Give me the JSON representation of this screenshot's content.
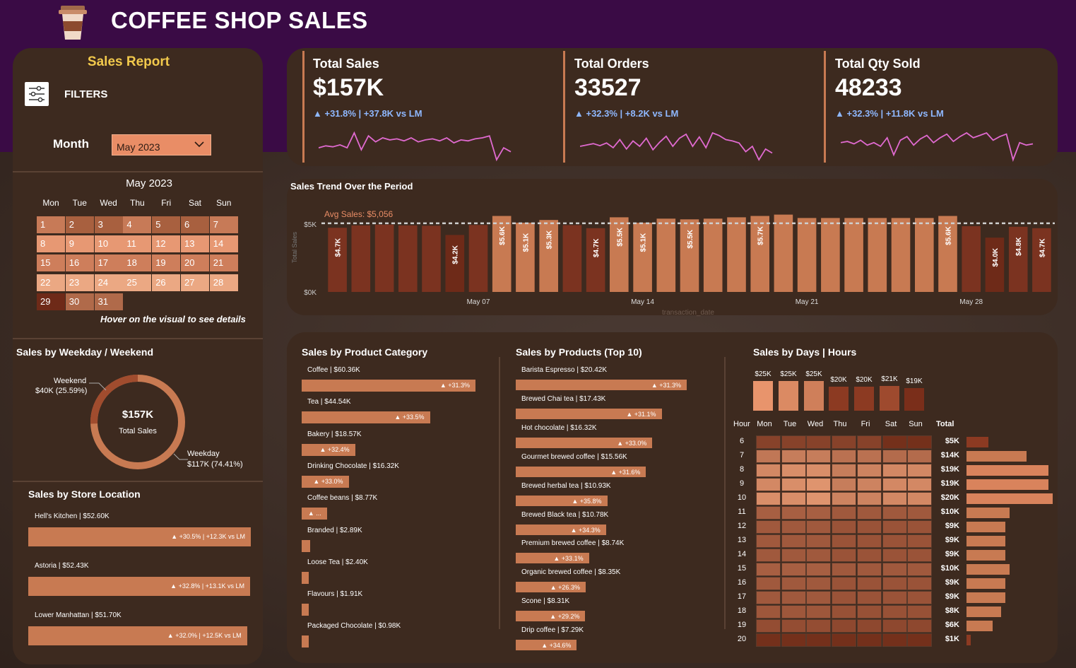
{
  "app": {
    "title": "COFFEE SHOP SALES"
  },
  "colors": {
    "accent": "#c87a52",
    "header_bg": "#3a0b45",
    "card_bg": "#3d2a1f",
    "delta_blue": "#8fb8ff",
    "sparkline": "#e06ad0",
    "gold": "#f2c94c"
  },
  "sidebar": {
    "report_title": "Sales Report",
    "filters_label": "FILTERS",
    "filters_icon": "sliders-icon",
    "month_label": "Month",
    "month_value": "May 2023",
    "calendar_title": "May 2023",
    "weekdays": [
      "Mon",
      "Tue",
      "Wed",
      "Thu",
      "Fri",
      "Sat",
      "Sun"
    ],
    "days": [
      "1",
      "2",
      "3",
      "4",
      "5",
      "6",
      "7",
      "8",
      "9",
      "10",
      "11",
      "12",
      "13",
      "14",
      "15",
      "16",
      "17",
      "18",
      "19",
      "20",
      "21",
      "22",
      "23",
      "24",
      "25",
      "26",
      "27",
      "28",
      "29",
      "30",
      "31"
    ],
    "hover_hint": "Hover on the visual to see details"
  },
  "kpis": [
    {
      "title": "Total Sales",
      "value": "$157K",
      "delta": "▲ +31.8% | +37.8K vs LM",
      "spark": [
        40,
        42,
        41,
        43,
        40,
        55,
        38,
        52,
        46,
        50,
        48,
        49,
        47,
        50,
        46,
        48,
        49,
        47,
        50,
        45,
        48,
        47,
        49,
        50,
        52,
        28,
        40,
        36
      ]
    },
    {
      "title": "Total Orders",
      "value": "33527",
      "delta": "▲ +32.3% | +8.2K vs LM",
      "spark": [
        30,
        32,
        34,
        31,
        35,
        28,
        40,
        26,
        38,
        30,
        42,
        25,
        36,
        45,
        30,
        42,
        48,
        30,
        44,
        28,
        50,
        46,
        40,
        38,
        35,
        22,
        30,
        10,
        26,
        20
      ]
    },
    {
      "title": "Total Qty Sold",
      "value": "48233",
      "delta": "▲ +32.3% | +11.8K vs LM",
      "spark": [
        40,
        41,
        39,
        42,
        38,
        40,
        37,
        44,
        30,
        42,
        45,
        38,
        43,
        46,
        40,
        44,
        47,
        41,
        45,
        48,
        44,
        46,
        48,
        42,
        45,
        47,
        26,
        40,
        38,
        39
      ]
    }
  ],
  "trend": {
    "title": "Sales Trend Over the Period",
    "avg_label": "Avg Sales: $5,056",
    "xlabel": "transaction_date",
    "ylabel": "Total Sales",
    "yticks": [
      "$5K",
      "$0K"
    ],
    "xticks": [
      "May 07",
      "May 14",
      "May 21",
      "May 28"
    ]
  },
  "chart_data": {
    "type": "bar",
    "title": "Sales Trend Over the Period",
    "xlabel": "transaction_date",
    "ylabel": "Total Sales",
    "avg": 5056,
    "ylim": [
      0,
      6000
    ],
    "categories": [
      "1",
      "2",
      "3",
      "4",
      "5",
      "6",
      "7",
      "8",
      "9",
      "10",
      "11",
      "12",
      "13",
      "14",
      "15",
      "16",
      "17",
      "18",
      "19",
      "20",
      "21",
      "22",
      "23",
      "24",
      "25",
      "26",
      "27",
      "28",
      "29",
      "30",
      "31"
    ],
    "values": [
      4731,
      4900,
      4960,
      4900,
      4880,
      4200,
      4930,
      5600,
      5100,
      5300,
      4920,
      4700,
      5500,
      5100,
      5400,
      5350,
      5400,
      5500,
      5600,
      5700,
      5450,
      5450,
      5450,
      5450,
      5450,
      5450,
      5600,
      4850,
      4000,
      4800,
      4700
    ],
    "bar_labels": {
      "0": "$4.7K",
      "5": "$4.2K",
      "7": "$5.6K",
      "8": "$5.1K",
      "9": "$5.3K",
      "11": "$4.7K",
      "12": "$5.5K",
      "13": "$5.1K",
      "15": "$5.5K",
      "18": "$5.7K",
      "26": "$5.6K",
      "28": "$4.0K",
      "29": "$4.8K",
      "30": "$4.7K"
    }
  },
  "weekday": {
    "title": "Sales by Weekday / Weekend",
    "center_value": "$157K",
    "center_label": "Total Sales",
    "weekend_label": "Weekend",
    "weekend_value": "$40K (25.59%)",
    "weekday_label": "Weekday",
    "weekday_value": "$117K (74.41%)",
    "weekend_pct": 25.59
  },
  "store": {
    "title": "Sales by Store Location",
    "items": [
      {
        "label": "Hell's Kitchen | $52.60K",
        "delta": "▲ +30.5% | +12.3K vs LM",
        "value": 52.6
      },
      {
        "label": "Astoria | $52.43K",
        "delta": "▲ +32.8% | +13.1K vs LM",
        "value": 52.43
      },
      {
        "label": "Lower Manhattan | $51.70K",
        "delta": "▲ +32.0% | +12.5K vs LM",
        "value": 51.7
      }
    ]
  },
  "category": {
    "title": "Sales by Product Category",
    "items": [
      {
        "label": "Coffee | $60.36K",
        "delta": "▲ +31.3%",
        "value": 60.36
      },
      {
        "label": "Tea | $44.54K",
        "delta": "▲ +33.5%",
        "value": 44.54
      },
      {
        "label": "Bakery | $18.57K",
        "delta": "▲ +32.4%",
        "value": 18.57
      },
      {
        "label": "Drinking Chocolate | $16.32K",
        "delta": "▲ +33.0%",
        "value": 16.32
      },
      {
        "label": "Coffee beans | $8.77K",
        "delta": "▲ ...",
        "value": 8.77
      },
      {
        "label": "Branded | $2.89K",
        "delta": "",
        "value": 2.89
      },
      {
        "label": "Loose Tea | $2.40K",
        "delta": "",
        "value": 2.4
      },
      {
        "label": "Flavours | $1.91K",
        "delta": "",
        "value": 1.91
      },
      {
        "label": "Packaged Chocolate | $0.98K",
        "delta": "",
        "value": 0.98
      }
    ]
  },
  "products": {
    "title": "Sales by Products (Top 10)",
    "items": [
      {
        "label": "Barista Espresso | $20.42K",
        "delta": "▲ +31.3%",
        "value": 20.42
      },
      {
        "label": "Brewed Chai tea | $17.43K",
        "delta": "▲ +31.1%",
        "value": 17.43
      },
      {
        "label": "Hot chocolate | $16.32K",
        "delta": "▲ +33.0%",
        "value": 16.32
      },
      {
        "label": "Gourmet brewed coffee | $15.56K",
        "delta": "▲ +31.6%",
        "value": 15.56
      },
      {
        "label": "Brewed herbal tea | $10.93K",
        "delta": "▲ +35.8%",
        "value": 10.93
      },
      {
        "label": "Brewed Black tea | $10.78K",
        "delta": "▲ +34.3%",
        "value": 10.78
      },
      {
        "label": "Premium brewed coffee | $8.74K",
        "delta": "▲ +33.1%",
        "value": 8.74
      },
      {
        "label": "Organic brewed coffee | $8.35K",
        "delta": "▲ +26.3%",
        "value": 8.35
      },
      {
        "label": "Scone | $8.31K",
        "delta": "▲ +29.2%",
        "value": 8.31
      },
      {
        "label": "Drip coffee | $7.29K",
        "delta": "▲ +34.6%",
        "value": 7.29
      }
    ]
  },
  "days_hours": {
    "title": "Sales by Days | Hours",
    "day_totals": [
      {
        "label": "$25K",
        "value": 25,
        "color": "#e8946c"
      },
      {
        "label": "$25K",
        "value": 25,
        "color": "#db8a63"
      },
      {
        "label": "$25K",
        "value": 25,
        "color": "#cf7f5a"
      },
      {
        "label": "$20K",
        "value": 20,
        "color": "#8c3a22"
      },
      {
        "label": "$20K",
        "value": 20,
        "color": "#8c3a22"
      },
      {
        "label": "$21K",
        "value": 21,
        "color": "#9e4a2e"
      },
      {
        "label": "$19K",
        "value": 19,
        "color": "#7a2e1a"
      }
    ],
    "hour_header": "Hour",
    "total_header": "Total",
    "days": [
      "Mon",
      "Tue",
      "Wed",
      "Thu",
      "Fri",
      "Sat",
      "Sun"
    ],
    "hours": [
      "6",
      "7",
      "8",
      "9",
      "10",
      "11",
      "12",
      "13",
      "14",
      "15",
      "16",
      "17",
      "18",
      "19",
      "20"
    ],
    "hour_totals": [
      {
        "label": "$5K",
        "value": 5
      },
      {
        "label": "$14K",
        "value": 14
      },
      {
        "label": "$19K",
        "value": 19
      },
      {
        "label": "$19K",
        "value": 19
      },
      {
        "label": "$20K",
        "value": 20
      },
      {
        "label": "$10K",
        "value": 10
      },
      {
        "label": "$9K",
        "value": 9
      },
      {
        "label": "$9K",
        "value": 9
      },
      {
        "label": "$9K",
        "value": 9
      },
      {
        "label": "$10K",
        "value": 10
      },
      {
        "label": "$9K",
        "value": 9
      },
      {
        "label": "$9K",
        "value": 9
      },
      {
        "label": "$8K",
        "value": 8
      },
      {
        "label": "$6K",
        "value": 6
      },
      {
        "label": "$1K",
        "value": 1
      }
    ],
    "heat": [
      [
        0.2,
        0.2,
        0.2,
        0.2,
        0.2,
        0.05,
        0.05
      ],
      [
        0.65,
        0.7,
        0.7,
        0.6,
        0.6,
        0.55,
        0.55
      ],
      [
        0.8,
        0.85,
        0.85,
        0.7,
        0.75,
        0.8,
        0.8
      ],
      [
        0.8,
        0.85,
        0.9,
        0.7,
        0.75,
        0.8,
        0.8
      ],
      [
        0.85,
        0.85,
        0.9,
        0.75,
        0.75,
        0.8,
        0.8
      ],
      [
        0.45,
        0.45,
        0.45,
        0.4,
        0.4,
        0.4,
        0.4
      ],
      [
        0.4,
        0.4,
        0.4,
        0.35,
        0.35,
        0.35,
        0.35
      ],
      [
        0.4,
        0.4,
        0.4,
        0.35,
        0.35,
        0.35,
        0.35
      ],
      [
        0.4,
        0.4,
        0.4,
        0.35,
        0.35,
        0.35,
        0.35
      ],
      [
        0.45,
        0.45,
        0.45,
        0.4,
        0.4,
        0.4,
        0.4
      ],
      [
        0.4,
        0.4,
        0.4,
        0.35,
        0.35,
        0.35,
        0.35
      ],
      [
        0.4,
        0.4,
        0.4,
        0.35,
        0.35,
        0.35,
        0.35
      ],
      [
        0.38,
        0.38,
        0.38,
        0.33,
        0.33,
        0.33,
        0.33
      ],
      [
        0.3,
        0.3,
        0.3,
        0.25,
        0.25,
        0.25,
        0.25
      ],
      [
        0.05,
        0.05,
        0.05,
        0.05,
        0.05,
        0.05,
        0.05
      ]
    ]
  }
}
